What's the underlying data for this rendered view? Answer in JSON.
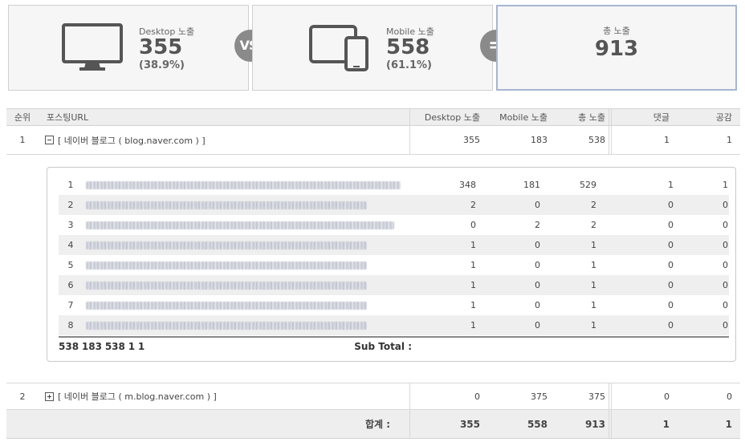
{
  "summary": {
    "desktop": {
      "label": "Desktop 노출",
      "value": "355",
      "pct": "(38.9%)",
      "icon": "monitor-icon"
    },
    "vs": "VS.",
    "mobile": {
      "label": "Mobile 노출",
      "value": "558",
      "pct": "(61.1%)",
      "icon": "tablet-phone-icon"
    },
    "equals": "=",
    "total": {
      "label": "총 노출",
      "value": "913"
    }
  },
  "table": {
    "headers": {
      "rank": "순위",
      "url": "포스팅URL",
      "desktop": "Desktop 노출",
      "mobile": "Mobile 노출",
      "total": "총 노출",
      "comments": "댓글",
      "likes": "공감"
    },
    "rows": [
      {
        "rank": "1",
        "url": "[ 네이버 블로그 ( blog.naver.com ) ]",
        "expanded": true,
        "desktop": "355",
        "mobile": "183",
        "total": "538",
        "comments": "1",
        "likes": "1"
      },
      {
        "rank": "2",
        "url": "[ 네이버 블로그 ( m.blog.naver.com ) ]",
        "expanded": false,
        "desktop": "0",
        "mobile": "375",
        "total": "375",
        "comments": "0",
        "likes": "0"
      }
    ],
    "detail": [
      {
        "n": "1",
        "desktop": "348",
        "mobile": "181",
        "total": "529",
        "comments": "1",
        "likes": "1"
      },
      {
        "n": "2",
        "desktop": "2",
        "mobile": "0",
        "total": "2",
        "comments": "0",
        "likes": "0"
      },
      {
        "n": "3",
        "desktop": "0",
        "mobile": "2",
        "total": "2",
        "comments": "0",
        "likes": "0"
      },
      {
        "n": "4",
        "desktop": "1",
        "mobile": "0",
        "total": "1",
        "comments": "0",
        "likes": "0"
      },
      {
        "n": "5",
        "desktop": "1",
        "mobile": "0",
        "total": "1",
        "comments": "0",
        "likes": "0"
      },
      {
        "n": "6",
        "desktop": "1",
        "mobile": "0",
        "total": "1",
        "comments": "0",
        "likes": "0"
      },
      {
        "n": "7",
        "desktop": "1",
        "mobile": "0",
        "total": "1",
        "comments": "0",
        "likes": "0"
      },
      {
        "n": "8",
        "desktop": "1",
        "mobile": "0",
        "total": "1",
        "comments": "0",
        "likes": "0"
      }
    ],
    "subtotal": {
      "label": "Sub Total :",
      "desktop": "538",
      "mobile": "183",
      "total": "538",
      "comments": "1",
      "likes": "1"
    },
    "grand_total": {
      "label": "합계 :",
      "desktop": "355",
      "mobile": "558",
      "total": "913",
      "comments": "1",
      "likes": "1"
    }
  },
  "colors": {
    "card_bg": "#f6f6f6",
    "operator": "#8a8a8a",
    "total_border": "#a7b6d0",
    "header_bg": "#eeeeee"
  }
}
